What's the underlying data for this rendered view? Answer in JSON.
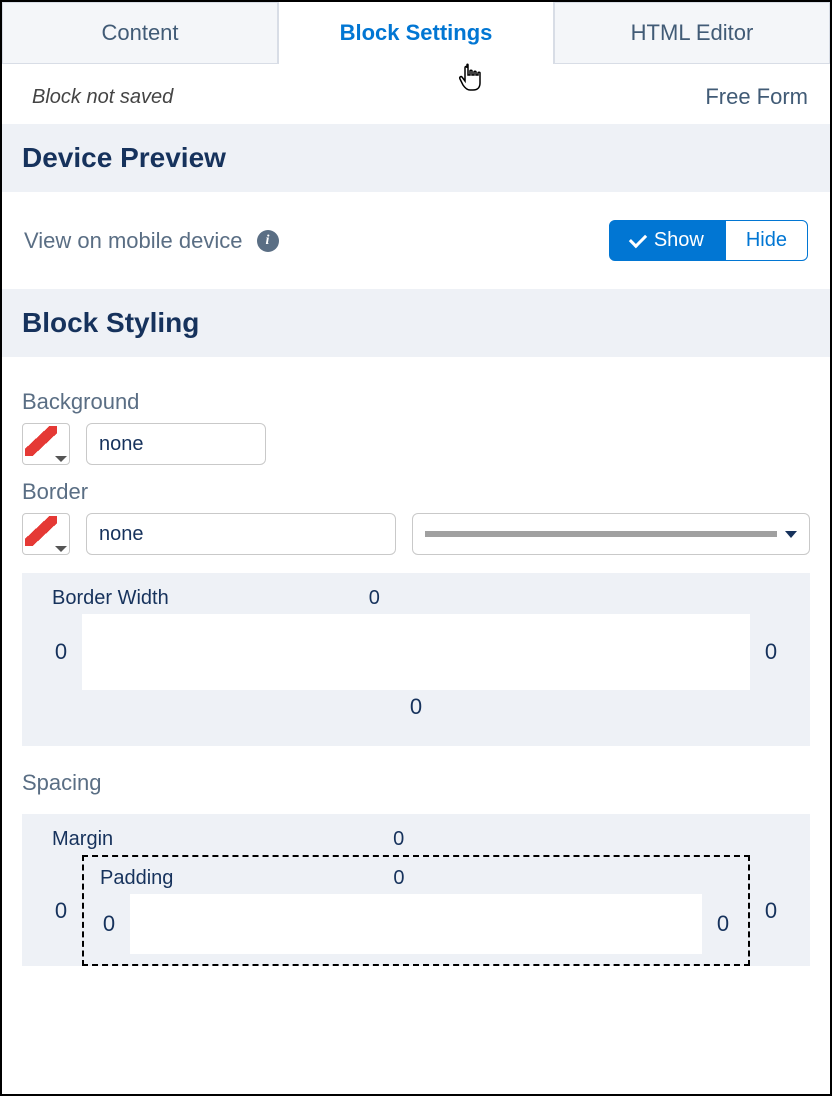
{
  "tabs": {
    "content": "Content",
    "blockSettings": "Block Settings",
    "htmlEditor": "HTML Editor"
  },
  "status": {
    "notSaved": "Block not saved",
    "freeForm": "Free Form"
  },
  "devicePreview": {
    "heading": "Device Preview",
    "viewMobile": "View on mobile device",
    "show": "Show",
    "hide": "Hide"
  },
  "blockStyling": {
    "heading": "Block Styling",
    "backgroundLabel": "Background",
    "backgroundValue": "none",
    "borderLabel": "Border",
    "borderValue": "none",
    "borderWidth": {
      "label": "Border Width",
      "top": "0",
      "right": "0",
      "bottom": "0",
      "left": "0"
    },
    "spacingLabel": "Spacing",
    "margin": {
      "label": "Margin",
      "top": "0",
      "right": "0",
      "left": "0"
    },
    "padding": {
      "label": "Padding",
      "top": "0",
      "right": "0",
      "left": "0"
    }
  }
}
